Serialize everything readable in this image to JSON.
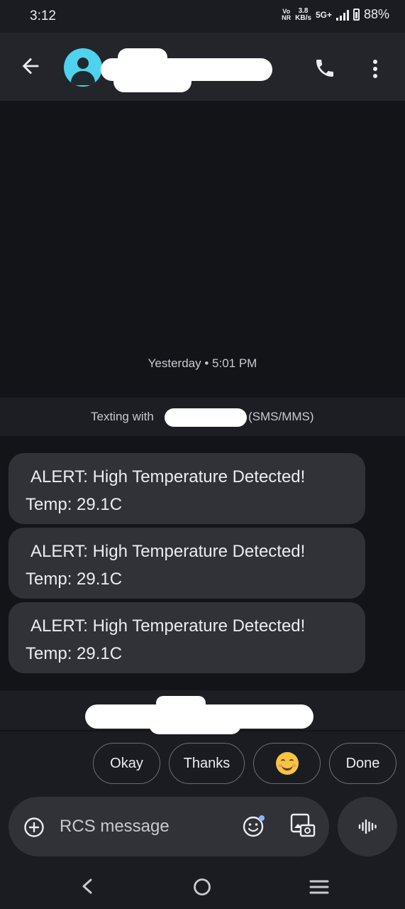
{
  "status_bar": {
    "time": "3:12",
    "volte_top": "Vo",
    "volte_bottom": "NR",
    "speed_top": "3.8",
    "speed_bottom": "KB/s",
    "network": "5G+",
    "battery": "88%"
  },
  "header": {
    "back_icon": "arrow-left-icon",
    "avatar_icon": "person-icon",
    "avatar_color": "#4fd2ee",
    "call_icon": "phone-icon",
    "menu_icon": "more-vert-icon"
  },
  "conversation": {
    "timestamp": "Yesterday • 5:01 PM",
    "texting_prefix": "Texting with",
    "texting_suffix": "(SMS/MMS)",
    "messages": [
      {
        "line1": "ALERT: High Temperature Detected!",
        "line2": "Temp: 29.1C"
      },
      {
        "line1": "ALERT: High Temperature Detected!",
        "line2": "Temp: 29.1C"
      },
      {
        "line1": "ALERT: High Temperature Detected!",
        "line2": "Temp: 29.1C"
      }
    ]
  },
  "suggestions": [
    "Okay",
    "Thanks",
    "😊",
    "Done"
  ],
  "composer": {
    "placeholder": "RCS message",
    "add_icon": "add-circle-icon",
    "emoji_icon": "emoji-icon",
    "gallery_icon": "gallery-icon",
    "voice_icon": "voice-waveform-icon"
  },
  "nav_bar": {
    "back_icon": "nav-back-icon",
    "home_icon": "nav-home-icon",
    "recents_icon": "nav-recents-icon"
  }
}
